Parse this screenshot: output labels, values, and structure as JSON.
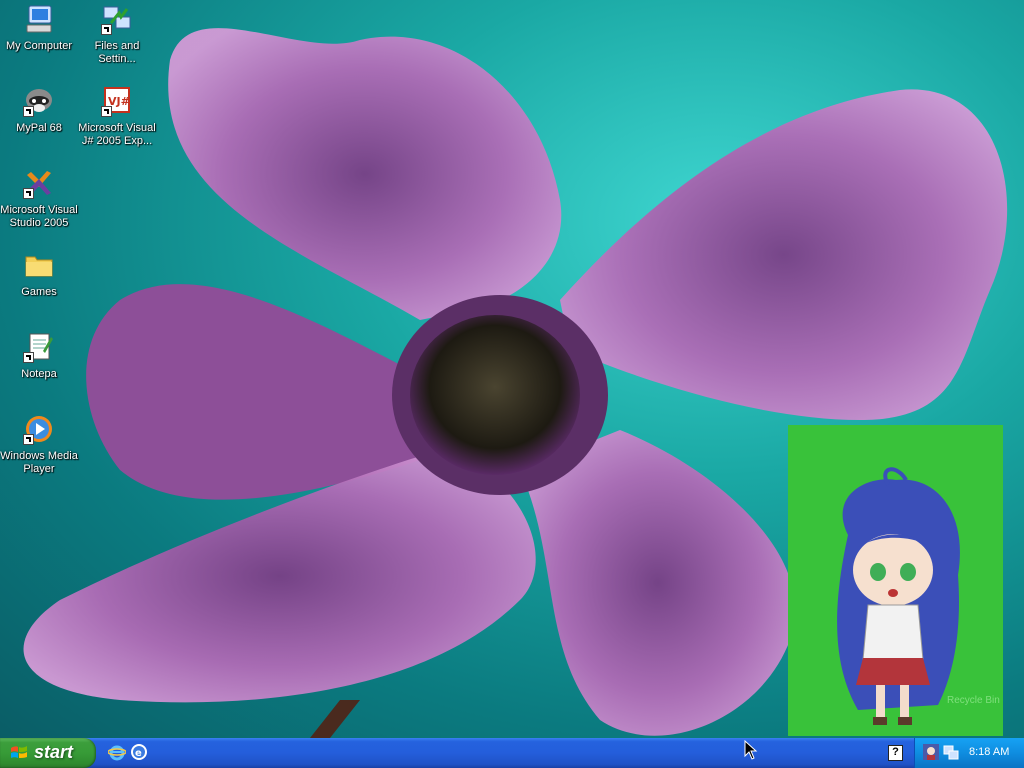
{
  "desktop_icons": [
    {
      "label": "My Computer",
      "icon": "my-computer-icon"
    },
    {
      "label": "Files and Settin...",
      "icon": "files-settings-transfer-icon"
    },
    {
      "label": "MyPal 68",
      "icon": "mypal-raccoon-icon"
    },
    {
      "label": "Microsoft Visual J# 2005 Exp...",
      "icon": "visual-jsharp-icon"
    },
    {
      "label": "Microsoft Visual Studio 2005",
      "icon": "visual-studio-icon"
    },
    {
      "label": "Games",
      "icon": "folder-icon"
    },
    {
      "label": "Notepa",
      "icon": "notepad-icon"
    },
    {
      "label": "Windows Media Player",
      "icon": "windows-media-player-icon"
    }
  ],
  "desktop_widget": {
    "recycle_label": "Recycle Bin",
    "icon": "anime-character-image"
  },
  "taskbar": {
    "start_label": "start",
    "quick_launch": [
      "internet-explorer-icon",
      "mypal-browser-icon"
    ],
    "help_label": "?",
    "tray_icons": [
      "character-tray-icon",
      "network-tray-icon"
    ],
    "clock": "8:18 AM"
  },
  "colors": {
    "taskbar": "#245edb",
    "start": "#379b37",
    "widget_bg": "#39c23a",
    "tray": "#0f8de0"
  }
}
